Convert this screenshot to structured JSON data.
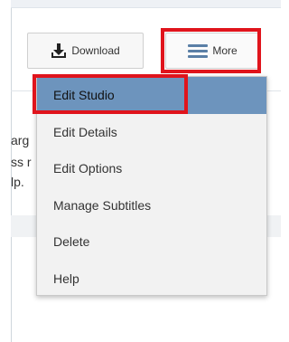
{
  "toolbar": {
    "download_label": "Download",
    "more_label": "More"
  },
  "background": {
    "line1": "arg",
    "line2": "ss r",
    "line3": "lp."
  },
  "menu": {
    "items": [
      {
        "label": "Edit Studio",
        "active": true
      },
      {
        "label": "Edit Details",
        "active": false
      },
      {
        "label": "Edit Options",
        "active": false
      },
      {
        "label": "Manage Subtitles",
        "active": false
      },
      {
        "label": "Delete",
        "active": false
      },
      {
        "label": "Help",
        "active": false
      }
    ]
  },
  "colors": {
    "highlight": "#e0141c",
    "active_item": "#6d94bd",
    "menu_bg": "#f2f2f2",
    "hamburger": "#5a7fa6"
  },
  "icons": [
    "download-icon",
    "hamburger-icon"
  ]
}
